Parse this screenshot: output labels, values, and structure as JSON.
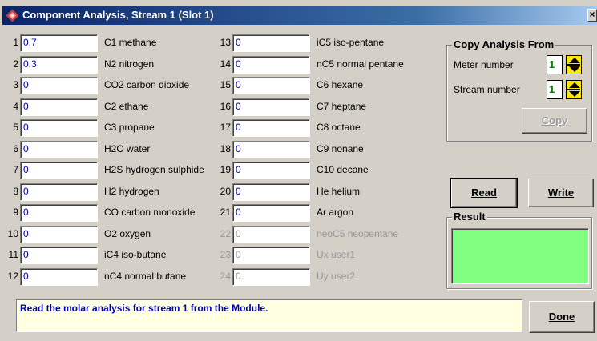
{
  "window": {
    "title": "Component Analysis, Stream 1 (Slot 1)",
    "close_label": "×"
  },
  "components_left": [
    {
      "num": "1",
      "value": "0.7",
      "name": "C1 methane",
      "enabled": true
    },
    {
      "num": "2",
      "value": "0.3",
      "name": "N2 nitrogen",
      "enabled": true
    },
    {
      "num": "3",
      "value": "0",
      "name": "CO2 carbon dioxide",
      "enabled": true
    },
    {
      "num": "4",
      "value": "0",
      "name": "C2 ethane",
      "enabled": true
    },
    {
      "num": "5",
      "value": "0",
      "name": "C3 propane",
      "enabled": true
    },
    {
      "num": "6",
      "value": "0",
      "name": "H2O water",
      "enabled": true
    },
    {
      "num": "7",
      "value": "0",
      "name": "H2S hydrogen sulphide",
      "enabled": true
    },
    {
      "num": "8",
      "value": "0",
      "name": "H2 hydrogen",
      "enabled": true
    },
    {
      "num": "9",
      "value": "0",
      "name": "CO carbon monoxide",
      "enabled": true
    },
    {
      "num": "10",
      "value": "0",
      "name": "O2 oxygen",
      "enabled": true
    },
    {
      "num": "11",
      "value": "0",
      "name": "iC4 iso-butane",
      "enabled": true
    },
    {
      "num": "12",
      "value": "0",
      "name": "nC4 normal butane",
      "enabled": true
    }
  ],
  "components_right": [
    {
      "num": "13",
      "value": "0",
      "name": "iC5 iso-pentane",
      "enabled": true
    },
    {
      "num": "14",
      "value": "0",
      "name": "nC5 normal pentane",
      "enabled": true
    },
    {
      "num": "15",
      "value": "0",
      "name": "C6 hexane",
      "enabled": true
    },
    {
      "num": "16",
      "value": "0",
      "name": "C7 heptane",
      "enabled": true
    },
    {
      "num": "17",
      "value": "0",
      "name": "C8 octane",
      "enabled": true
    },
    {
      "num": "18",
      "value": "0",
      "name": "C9 nonane",
      "enabled": true
    },
    {
      "num": "19",
      "value": "0",
      "name": "C10 decane",
      "enabled": true
    },
    {
      "num": "20",
      "value": "0",
      "name": "He helium",
      "enabled": true
    },
    {
      "num": "21",
      "value": "0",
      "name": "Ar argon",
      "enabled": true
    },
    {
      "num": "22",
      "value": "0",
      "name": "neoC5 neopentane",
      "enabled": false
    },
    {
      "num": "23",
      "value": "0",
      "name": "Ux user1",
      "enabled": false
    },
    {
      "num": "24",
      "value": "0",
      "name": "Uy user2",
      "enabled": false
    }
  ],
  "copy_group": {
    "legend": "Copy Analysis From",
    "meter_label": "Meter number",
    "meter_value": "1",
    "stream_label": "Stream number",
    "stream_value": "1",
    "copy_button": "Copy"
  },
  "buttons": {
    "read": "Read",
    "write": "Write",
    "done": "Done"
  },
  "result_group": {
    "legend": "Result",
    "color": "#80ff80"
  },
  "status_text": "Read the molar analysis for stream 1 from the Module.",
  "colors": {
    "title_bar": "#0a246a",
    "value_text": "#0000b4",
    "status_text": "#0000c0",
    "status_bg": "#ffffe1",
    "spinner_value": "#008000",
    "spinner_button": "#ffe800"
  },
  "icons": {
    "title": "app-diamond-icon",
    "spin_up": "triangle-up-icon",
    "spin_down": "triangle-down-icon"
  }
}
